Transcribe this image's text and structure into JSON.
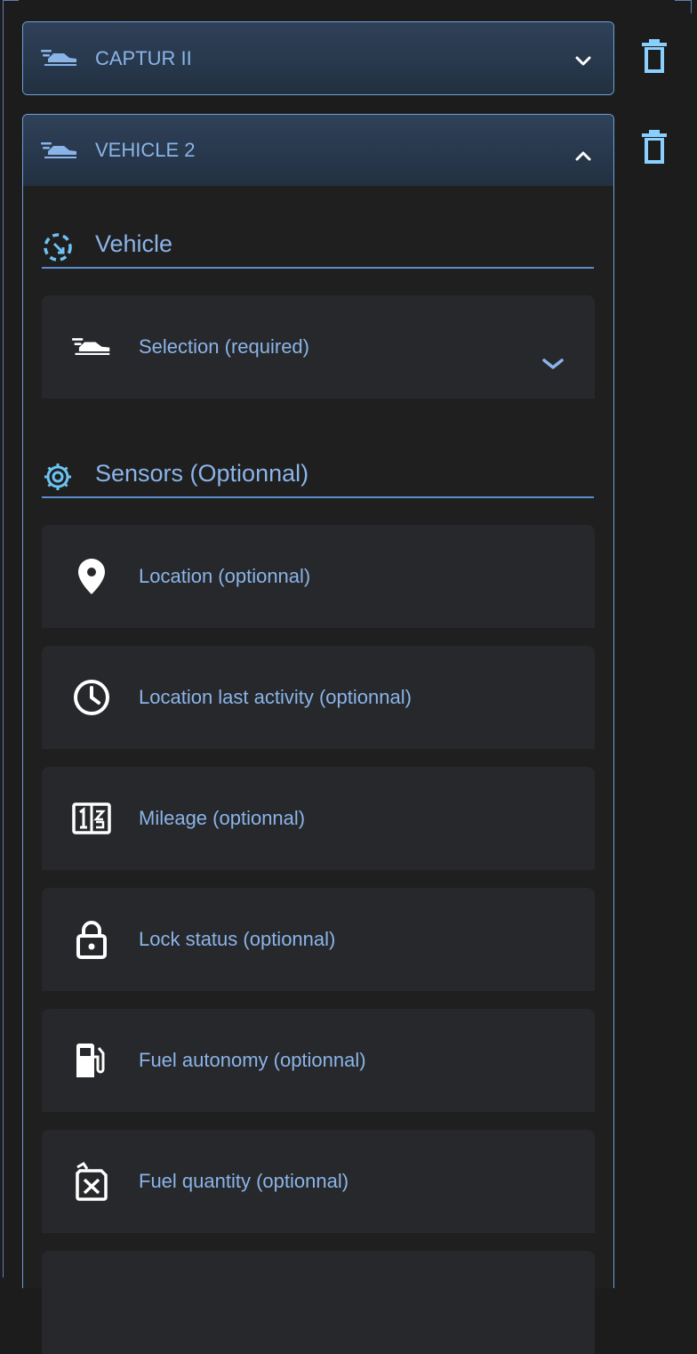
{
  "vehicles": [
    {
      "title": "CAPTUR II",
      "expanded": false
    },
    {
      "title": "VEHICLE 2",
      "expanded": true
    }
  ],
  "vehicle_section": {
    "title": "Vehicle",
    "selection_label": "Selection (required)"
  },
  "sensors_section": {
    "title": "Sensors (Optionnal)",
    "fields": [
      {
        "label": "Location (optionnal)",
        "icon": "location-pin-icon"
      },
      {
        "label": "Location last activity (optionnal)",
        "icon": "clock-icon"
      },
      {
        "label": "Mileage (optionnal)",
        "icon": "odometer-icon"
      },
      {
        "label": "Lock status (optionnal)",
        "icon": "lock-icon"
      },
      {
        "label": "Fuel autonomy (optionnal)",
        "icon": "fuel-pump-icon"
      },
      {
        "label": "Fuel quantity (optionnal)",
        "icon": "jerrycan-icon"
      }
    ]
  },
  "colors": {
    "accent": "#8ab4e8",
    "border": "#6f9fd8",
    "background": "#1c1c1d",
    "field_bg": "#27282b",
    "trash": "#8ad0ff"
  }
}
